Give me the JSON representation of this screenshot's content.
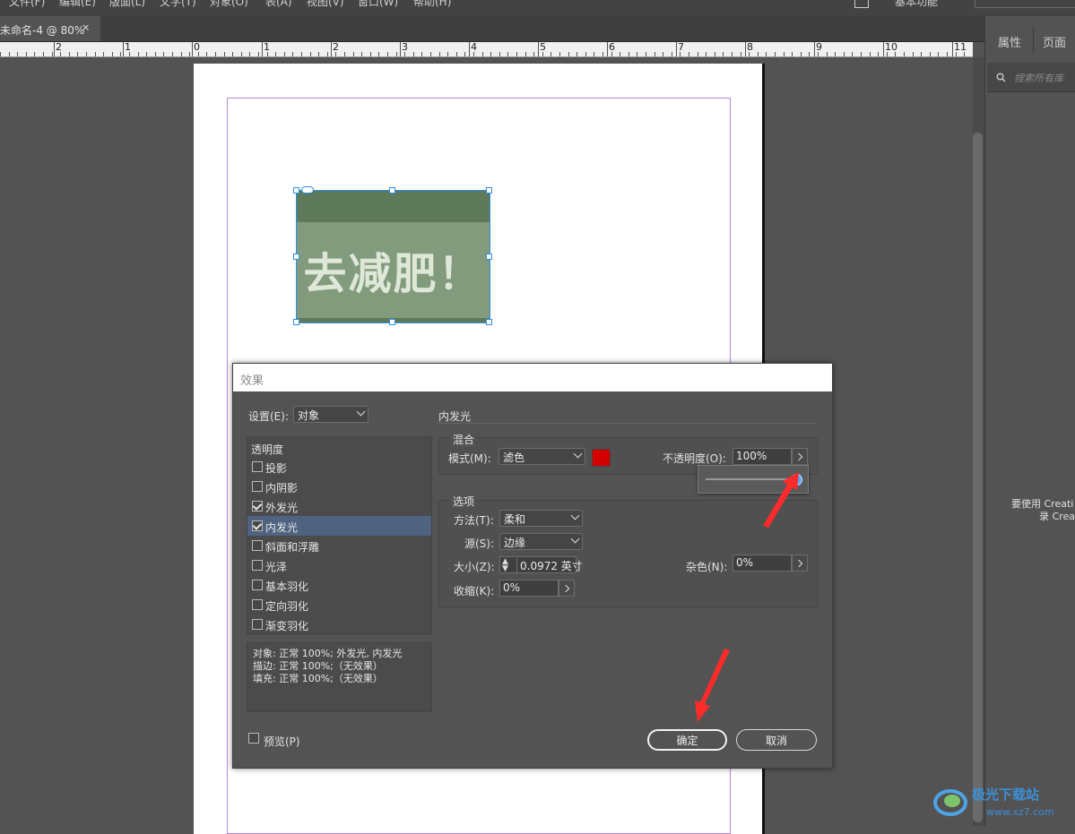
{
  "menubar": {
    "items": [
      "文件(F)",
      "编辑(E)",
      "版面(L)",
      "文字(T)",
      "对象(O)",
      "表(A)",
      "视图(V)",
      "窗口(W)",
      "帮助(H)"
    ],
    "workspace": "基本功能"
  },
  "tab": {
    "title": "未命名-4 @ 80%",
    "close": "×"
  },
  "ruler": {
    "labels": [
      "2",
      "1",
      "0",
      "1",
      "2",
      "3",
      "4",
      "5",
      "6",
      "7",
      "8",
      "9",
      "10",
      "11"
    ]
  },
  "artwork": {
    "text": "去减肥！"
  },
  "right_panel": {
    "tabs": [
      "属性",
      "页面"
    ],
    "search_placeholder": "搜索所有库",
    "message_line1": "要使用 Creati",
    "message_line2": "录 Crea"
  },
  "dialog": {
    "title": "效果",
    "settings_label": "设置(E):",
    "settings_value": "对象",
    "section_title": "内发光",
    "list_header": "透明度",
    "effects": [
      {
        "label": "投影",
        "checked": false,
        "selected": false
      },
      {
        "label": "内阴影",
        "checked": false,
        "selected": false
      },
      {
        "label": "外发光",
        "checked": true,
        "selected": false
      },
      {
        "label": "内发光",
        "checked": true,
        "selected": true
      },
      {
        "label": "斜面和浮雕",
        "checked": false,
        "selected": false
      },
      {
        "label": "光泽",
        "checked": false,
        "selected": false
      },
      {
        "label": "基本羽化",
        "checked": false,
        "selected": false
      },
      {
        "label": "定向羽化",
        "checked": false,
        "selected": false
      },
      {
        "label": "渐变羽化",
        "checked": false,
        "selected": false
      }
    ],
    "summary": [
      "对象: 正常 100%; 外发光, 内发光",
      "描边: 正常 100%;（无效果）",
      "填充: 正常 100%;（无效果）"
    ],
    "blend": {
      "group_label": "混合",
      "mode_label": "模式(M):",
      "mode_value": "滤色",
      "color": "#d40000",
      "opacity_label": "不透明度(O):",
      "opacity_value": "100%",
      "opacity_slider": 1.0
    },
    "options": {
      "group_label": "选项",
      "method_label": "方法(T):",
      "method_value": "柔和",
      "source_label": "源(S):",
      "source_value": "边缘",
      "size_label": "大小(Z):",
      "size_value": "0.0972 英寸",
      "noise_label": "杂色(N):",
      "noise_value": "0%",
      "choke_label": "收缩(K):",
      "choke_value": "0%"
    },
    "preview_label": "预览(P)",
    "ok_label": "确定",
    "cancel_label": "取消"
  },
  "watermark": {
    "text": "极光下载站",
    "url": "www.xz7.com"
  }
}
